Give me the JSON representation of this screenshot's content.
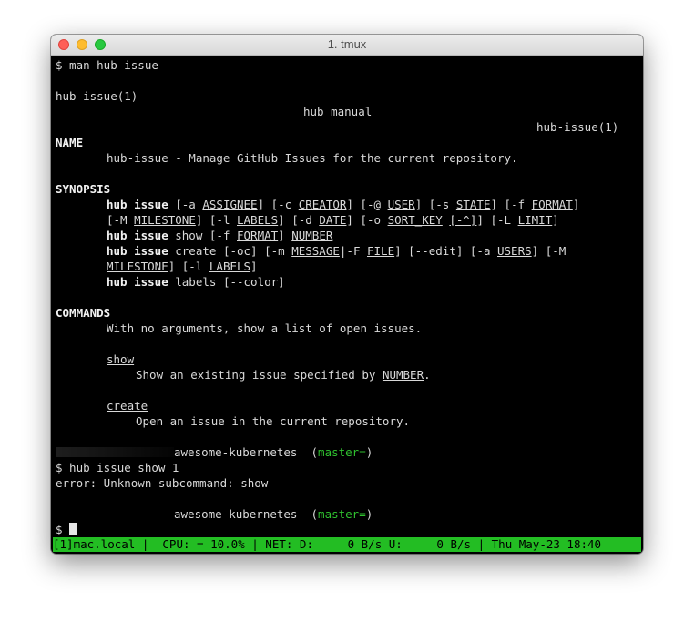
{
  "window": {
    "title": "1. tmux"
  },
  "colors": {
    "status_bar": "#23bd23",
    "branch": "#2fc12f",
    "terminal_bg": "#000000"
  },
  "terminal": {
    "cmd_man": "$ man hub-issue",
    "header": {
      "left": "hub-issue(1)",
      "center": "hub manual",
      "right": "hub-issue(1)"
    },
    "name_heading": "NAME",
    "name_desc": "hub-issue - Manage GitHub Issues for the current repository.",
    "synopsis_heading": "SYNOPSIS",
    "syn1": {
      "cmd": "hub issue",
      "p1": " [-a ",
      "assignee": "ASSIGNEE",
      "p2": "] [-c ",
      "creator": "CREATOR",
      "p3": "] [-@ ",
      "user": "USER",
      "p4": "] [-s ",
      "state": "STATE",
      "p5": "] [-f ",
      "format": "FORMAT",
      "p6": "]"
    },
    "syn2": {
      "p1": "[-M ",
      "milestone": "MILESTONE",
      "p2": "] [-l ",
      "labels": "LABELS",
      "p3": "] [-d ",
      "date": "DATE",
      "p4": "] [-o ",
      "sort_key": "SORT_KEY",
      "p5": " ",
      "caret": "[-^]",
      "p6": "] [-L ",
      "limit": "LIMIT",
      "p7": "]"
    },
    "syn3": {
      "cmd": "hub issue",
      "p1": " show [-f ",
      "format": "FORMAT",
      "p2": "] ",
      "number": "NUMBER"
    },
    "syn4": {
      "cmd": "hub issue",
      "p1": " create [-oc] [-m ",
      "message": "MESSAGE",
      "p2": "|-F ",
      "file": "FILE",
      "p3": "] [--edit] [-a ",
      "users": "USERS",
      "p4": "] [-M"
    },
    "syn5": {
      "milestone": "MILESTONE",
      "p1": "] [-l ",
      "labels": "LABELS",
      "p2": "]"
    },
    "syn6": {
      "cmd": "hub issue",
      "p1": " labels [--color]"
    },
    "commands_heading": "COMMANDS",
    "commands_desc": "With no arguments, show a list of open issues.",
    "show_label": "show",
    "show_desc_prefix": "Show an existing issue specified by ",
    "show_desc_number": "NUMBER",
    "show_desc_suffix": ".",
    "create_label": "create",
    "create_desc": "Open an issue in the current repository.",
    "prompt1_dir": "awesome-kubernetes",
    "prompt1_paren_open": "  (",
    "prompt1_branch": "master=",
    "prompt1_paren_close": ")",
    "cmd_show": "$ hub issue show 1",
    "error_msg": "error: Unknown subcommand: show",
    "prompt2_dir": "awesome-kubernetes",
    "prompt2_paren_open": "  (",
    "prompt2_branch": "master=",
    "prompt2_paren_close": ")",
    "final_prompt": "$ "
  },
  "statusbar": {
    "text": "[1]mac.local |  CPU: = 10.0% | NET: D:     0 B/s U:     0 B/s | Thu May-23 18:40"
  }
}
